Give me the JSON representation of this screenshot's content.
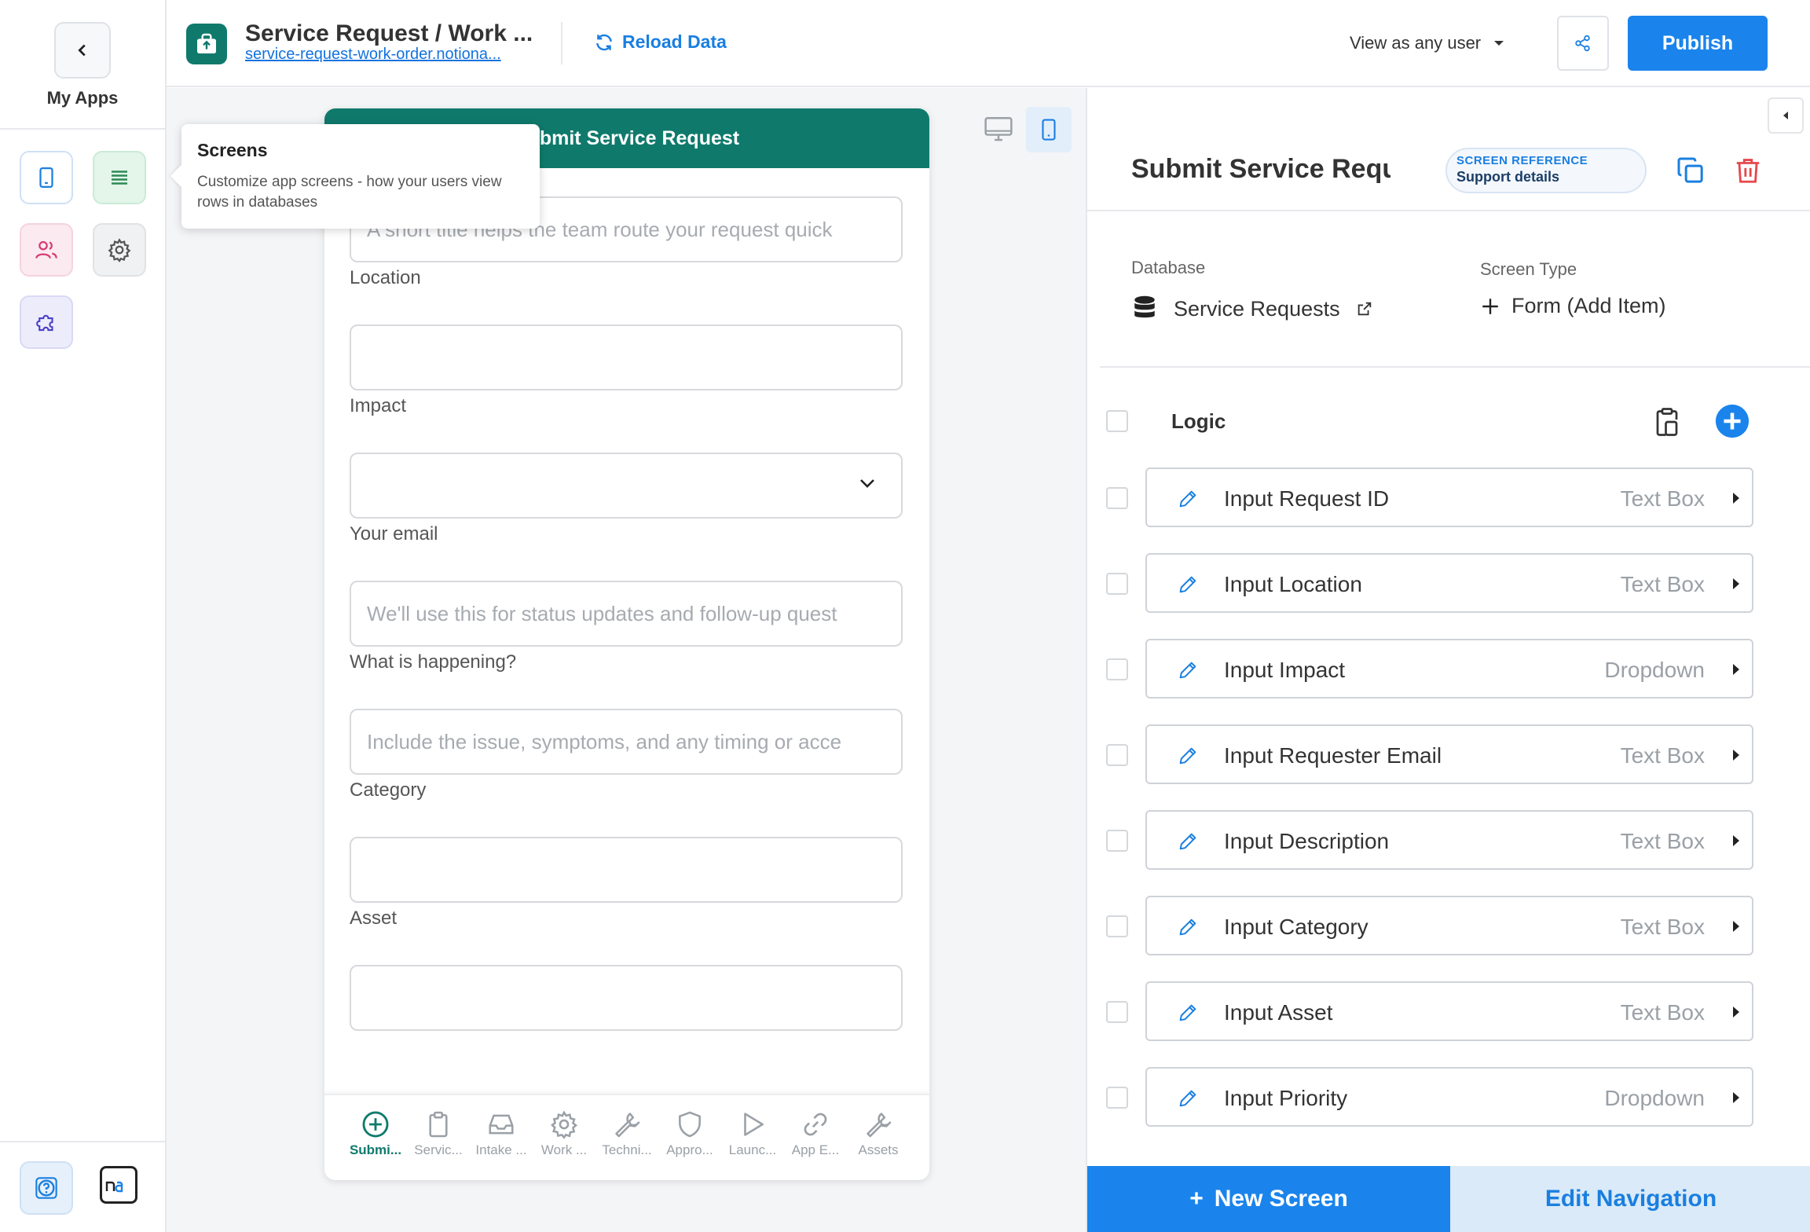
{
  "rail": {
    "my_apps_label": "My Apps"
  },
  "topbar": {
    "app_title": "Service Request / Work ...",
    "app_url": "service-request-work-order.notiona...",
    "reload_label": "Reload Data",
    "view_as_label": "View as any user",
    "publish_label": "Publish"
  },
  "tooltip": {
    "title": "Screens",
    "body": "Customize app screens - how your users view rows in databases"
  },
  "phone": {
    "header_title": "Submit Service Request",
    "fields": [
      {
        "label": "",
        "placeholder": "A short title helps the team route your request quick"
      },
      {
        "label": "Location",
        "placeholder": ""
      },
      {
        "label": "Impact",
        "placeholder": ""
      },
      {
        "label": "Your email",
        "placeholder": "We'll use this for status updates and follow-up quest"
      },
      {
        "label": "What is happening?",
        "placeholder": "Include the issue, symptoms, and any timing or acce"
      },
      {
        "label": "Category",
        "placeholder": ""
      },
      {
        "label": "Asset",
        "placeholder": ""
      }
    ],
    "tabs": [
      {
        "label": "Submi...",
        "icon": "plus-circle-icon"
      },
      {
        "label": "Servic...",
        "icon": "clipboard-icon"
      },
      {
        "label": "Intake ...",
        "icon": "inbox-icon"
      },
      {
        "label": "Work ...",
        "icon": "gear-icon"
      },
      {
        "label": "Techni...",
        "icon": "wrench-icon"
      },
      {
        "label": "Appro...",
        "icon": "shield-icon"
      },
      {
        "label": "Launc...",
        "icon": "play-icon"
      },
      {
        "label": "App E...",
        "icon": "link-icon"
      },
      {
        "label": "Assets",
        "icon": "wrench-icon"
      }
    ]
  },
  "panel": {
    "screen_title": "Submit Service Request",
    "ref_badge_top": "SCREEN REFERENCE",
    "ref_badge_bottom": "Support details",
    "database_label": "Database",
    "database_value": "Service Requests",
    "screen_type_label": "Screen Type",
    "screen_type_value": "Form (Add Item)",
    "logic_label": "Logic",
    "items": [
      {
        "name": "Input Request ID",
        "type": "Text Box"
      },
      {
        "name": "Input Location",
        "type": "Text Box"
      },
      {
        "name": "Input Impact",
        "type": "Dropdown"
      },
      {
        "name": "Input Requester Email",
        "type": "Text Box"
      },
      {
        "name": "Input Description",
        "type": "Text Box"
      },
      {
        "name": "Input Category",
        "type": "Text Box"
      },
      {
        "name": "Input Asset",
        "type": "Text Box"
      },
      {
        "name": "Input Priority",
        "type": "Dropdown"
      }
    ],
    "new_screen_label": "New Screen",
    "edit_navigation_label": "Edit Navigation"
  },
  "colors": {
    "brand_teal": "#0f7a6c",
    "accent_blue": "#1a84ec",
    "delete_red": "#e5484d"
  }
}
